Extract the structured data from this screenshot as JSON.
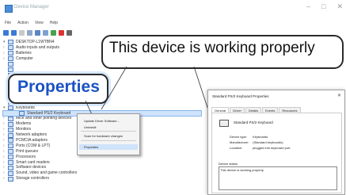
{
  "window": {
    "title": "Device Manager",
    "controls": [
      "–",
      "□",
      "✕"
    ]
  },
  "menu": [
    "File",
    "Action",
    "View",
    "Help"
  ],
  "toolbar_icons": [
    "back-icon",
    "forward-icon",
    "properties-icon",
    "scan-icon",
    "help-icon",
    "monitor-icon",
    "update-icon",
    "remove-icon",
    "disable-icon"
  ],
  "tree": [
    {
      "label": "DESKTOP-L1WTBN4",
      "exp": "▾",
      "sel": false
    },
    {
      "label": "Audio inputs and outputs",
      "exp": "›",
      "sel": false
    },
    {
      "label": "Batteries",
      "exp": "›",
      "sel": false
    },
    {
      "label": "Computer",
      "exp": "›",
      "sel": false
    },
    {
      "label": "",
      "exp": "",
      "sel": false
    },
    {
      "label": "",
      "exp": "",
      "sel": false
    },
    {
      "label": "",
      "exp": "",
      "sel": false
    },
    {
      "label": "",
      "exp": "",
      "sel": false
    },
    {
      "label": "",
      "exp": "",
      "sel": false
    },
    {
      "label": "",
      "exp": "",
      "sel": false
    },
    {
      "label": "",
      "exp": "",
      "sel": false
    },
    {
      "label": "",
      "exp": "",
      "sel": false
    },
    {
      "label": "Keyboards",
      "exp": "▾",
      "sel": false
    },
    {
      "label": "Standard PS/2 Keyboard",
      "exp": "",
      "sel": true
    },
    {
      "label": "Mice and other pointing devices",
      "exp": "›",
      "sel": false
    },
    {
      "label": "Modems",
      "exp": "›",
      "sel": false
    },
    {
      "label": "Monitors",
      "exp": "›",
      "sel": false
    },
    {
      "label": "Network adapters",
      "exp": "›",
      "sel": false
    },
    {
      "label": "PCMCIA adapters",
      "exp": "›",
      "sel": false
    },
    {
      "label": "Ports (COM & LPT)",
      "exp": "›",
      "sel": false
    },
    {
      "label": "Print queues",
      "exp": "›",
      "sel": false
    },
    {
      "label": "Processors",
      "exp": "›",
      "sel": false
    },
    {
      "label": "Smart card readers",
      "exp": "›",
      "sel": false
    },
    {
      "label": "Software devices",
      "exp": "›",
      "sel": false
    },
    {
      "label": "Sound, video and game controllers",
      "exp": "›",
      "sel": false
    },
    {
      "label": "Storage controllers",
      "exp": "›",
      "sel": false
    }
  ],
  "context_menu": {
    "items": [
      "Update Driver Software...",
      "Uninstall",
      "Scan for hardware changes",
      "Properties"
    ]
  },
  "callouts": {
    "properties": "Properties",
    "status": "This device is working properly"
  },
  "dialog": {
    "title": "Standard PS/2 Keyboard Properties",
    "close": "✕",
    "tabs": [
      "General",
      "Driver",
      "Details",
      "Events",
      "Resources"
    ],
    "device_name": "Standard PS/2 Keyboard",
    "props": [
      {
        "k": "Device type:",
        "v": "Keyboards"
      },
      {
        "k": "Manufacturer:",
        "v": "(Standard keyboards)"
      },
      {
        "k": "Location:",
        "v": "plugged into keyboard port"
      }
    ],
    "status_label": "Device status",
    "status_text": "This device is working properly."
  },
  "colors": {
    "accent": "#1a52c3",
    "selection": "#cfe3fb"
  }
}
